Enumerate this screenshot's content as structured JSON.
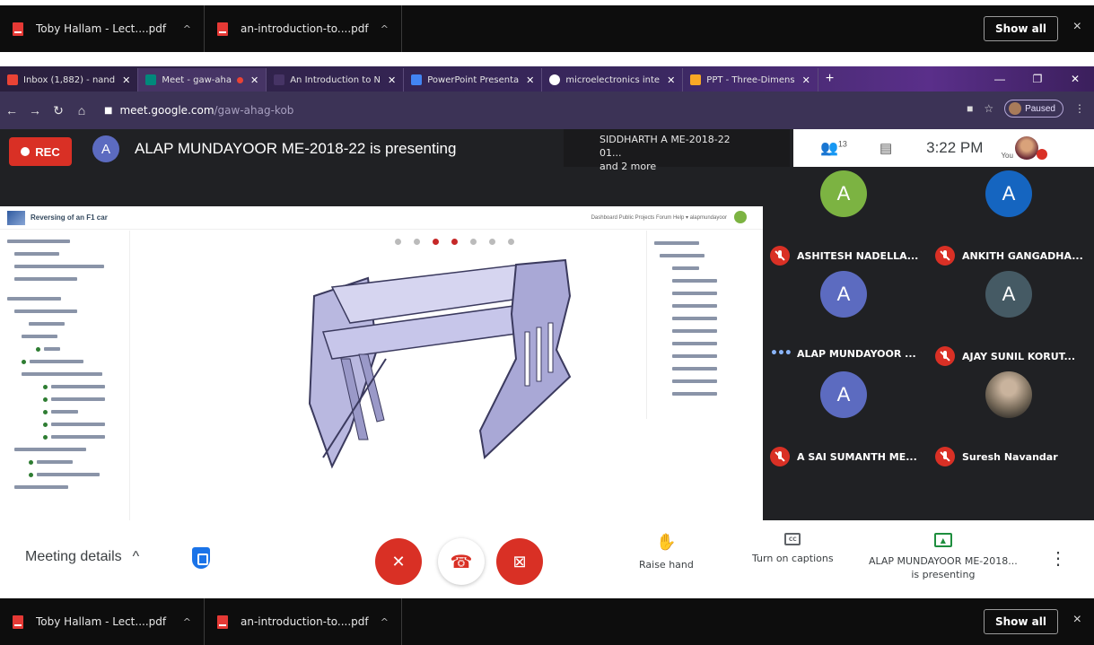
{
  "downloads": {
    "items": [
      {
        "name": "Toby Hallam - Lect....pdf",
        "icon": "pdf-icon"
      },
      {
        "name": "an-introduction-to....pdf",
        "icon": "pdf-icon"
      }
    ],
    "show_all": "Show all",
    "close": "×"
  },
  "tabs": [
    {
      "label": "Inbox (1,882) - nand",
      "favicon_color": "#ea4335"
    },
    {
      "label": "Meet - gaw-aha",
      "favicon_color": "#00897b",
      "active": true
    },
    {
      "label": "An Introduction to N",
      "favicon_color": "#463465"
    },
    {
      "label": "PowerPoint Presenta",
      "favicon_color": "#4285f4"
    },
    {
      "label": "microelectronics inte",
      "favicon_color": "#ffffff"
    },
    {
      "label": "PPT - Three-Dimens",
      "favicon_color": "#f9a825"
    }
  ],
  "address": {
    "host": "meet.google.com",
    "path": "/gaw-ahag-kob",
    "profile_status": "Paused"
  },
  "meet": {
    "rec_label": "REC",
    "presenter_initial": "A",
    "presenting_title": "ALAP MUNDAYOOR ME-2018-22 is presenting",
    "toast_line1": "SIDDHARTH A ME-2018-22 01...",
    "toast_line2": "and 2 more",
    "people_count": "13",
    "time": "3:22 PM",
    "you_label": "You"
  },
  "shared_screen": {
    "app_title": "Reversing of an F1 car",
    "nav_text": "Dashboard   Public Projects   Forum   Help ▾   alapmundayoor"
  },
  "participants": [
    {
      "initial": "A",
      "name": "ASHITESH NADELLA...",
      "color": "#7cb342",
      "muted": true
    },
    {
      "initial": "A",
      "name": "ANKITH GANGADHA...",
      "color": "#1565c0",
      "muted": true
    },
    {
      "initial": "A",
      "name": "ALAP MUNDAYOOR ...",
      "color": "#5c6bc0",
      "muted": false
    },
    {
      "initial": "A",
      "name": "AJAY SUNIL KORUT...",
      "color": "#455a64",
      "muted": true
    },
    {
      "initial": "A",
      "name": "A SAI SUMANTH ME...",
      "color": "#5c6bc0",
      "muted": true
    },
    {
      "initial": "",
      "name": "Suresh Navandar",
      "color": "#7a6d5c",
      "muted": true,
      "photo": true
    }
  ],
  "controls": {
    "meeting_details": "Meeting details",
    "raise_hand": "Raise hand",
    "captions": "Turn on captions",
    "presenting_line1": "ALAP MUNDAYOOR ME-2018...",
    "presenting_line2": "is presenting"
  }
}
